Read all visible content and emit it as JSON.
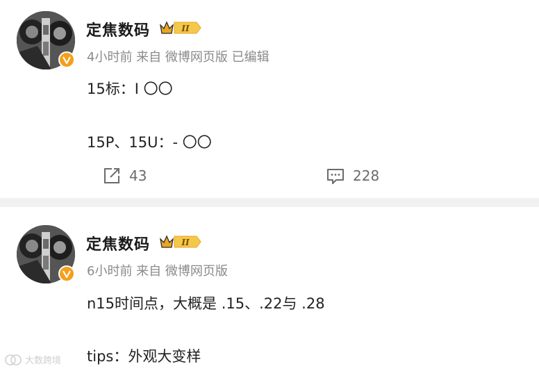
{
  "posts": [
    {
      "author": "定焦数码",
      "meta": "4小时前 来自 微博网页版 已编辑",
      "lines": [
        "15标：I 〇〇",
        "15P、15U：- 〇〇"
      ],
      "repost_count": "43",
      "comment_count": "228"
    },
    {
      "author": "定焦数码",
      "meta": "6小时前 来自 微博网页版",
      "lines": [
        "n15时间点，大概是 .15、.22与 .28",
        "tips：外观大变样"
      ]
    }
  ],
  "badge_label": "II",
  "watermark": "大数跨境",
  "colors": {
    "verified": "#f59f1b",
    "badge_gold": "#e9a623",
    "divider": "#f1f1f1",
    "meta": "#8a8a8a"
  }
}
